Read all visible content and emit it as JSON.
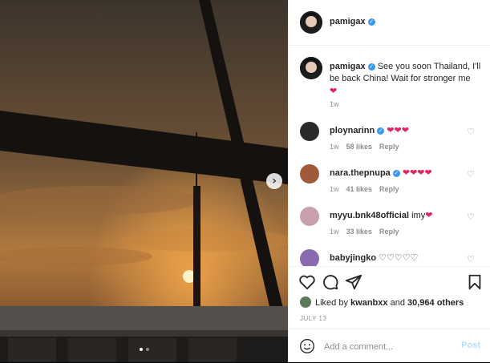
{
  "post": {
    "author": "pamigax",
    "caption": "See you soon Thailand, I'll be back China! Wait for stronger me",
    "caption_emoji": "❤",
    "age": "1w"
  },
  "comments": [
    {
      "user": "ploynarinn",
      "verified": true,
      "text": "❤❤❤",
      "is_emoji": true,
      "age": "1w",
      "likes": "58 likes",
      "reply": "Reply",
      "avatar_color": "#2b2b2b"
    },
    {
      "user": "nara.thepnupa",
      "verified": true,
      "text": "❤❤❤❤",
      "is_emoji": true,
      "age": "1w",
      "likes": "41 likes",
      "reply": "Reply",
      "avatar_color": "#a05a3a"
    },
    {
      "user": "myyu.bnk48official",
      "verified": false,
      "text": "imy",
      "trail_emoji": "❤",
      "age": "1w",
      "likes": "33 likes",
      "reply": "Reply",
      "avatar_color": "#c9a0b0"
    },
    {
      "user": "babyjingko",
      "verified": false,
      "text": "♡♡♡♡♡",
      "age": "",
      "likes": "",
      "reply": "",
      "avatar_color": "#8a6ab0"
    }
  ],
  "likes_summary": {
    "prefix": "Liked by",
    "user": "kwanbxx",
    "middle": "and",
    "count": "30,964 others"
  },
  "date": "JULY 13",
  "comment_box": {
    "placeholder": "Add a comment...",
    "post_label": "Post"
  },
  "carousel": {
    "next_icon": "chevron-right",
    "dot_count": 2,
    "active_index": 0
  },
  "colors": {
    "accent": "#3897f0",
    "heart": "#e0245e",
    "post_disabled": "#b2dffc"
  }
}
